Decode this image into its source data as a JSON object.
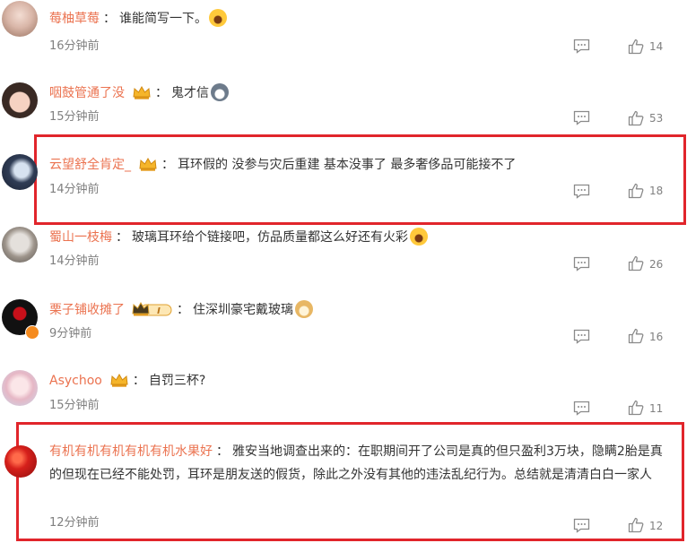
{
  "comments": [
    {
      "username": "莓柚草莓",
      "text": "谁能简写一下。",
      "time": "16分钟前",
      "likes": "14",
      "emoji": "surprised-emoji",
      "badge": "none"
    },
    {
      "username": "咽鼓管通了没",
      "text": "鬼才信",
      "time": "15分钟前",
      "likes": "53",
      "emoji": "husky-emoji",
      "badge": "crown"
    },
    {
      "username": "云望舒全肯定_",
      "text": "耳环假的 没参与灾后重建 基本没事了 最多奢侈品可能接不了",
      "time": "14分钟前",
      "likes": "18",
      "emoji": "",
      "badge": "crown"
    },
    {
      "username": "蜀山一枝梅",
      "text": "玻璃耳环给个链接吧，仿品质量都这么好还有火彩",
      "time": "14分钟前",
      "likes": "26",
      "emoji": "surprised-emoji",
      "badge": "none"
    },
    {
      "username": "栗子铺收摊了",
      "text": "住深圳豪宅戴玻璃",
      "time": "9分钟前",
      "likes": "16",
      "emoji": "doge-emoji",
      "badge": "crown-level",
      "badge_level": "I"
    },
    {
      "username": "Asychoo",
      "text": "自罚三杯?",
      "time": "15分钟前",
      "likes": "11",
      "emoji": "",
      "badge": "crown"
    },
    {
      "username": "有机有机有机有机有机水果好",
      "text": "雅安当地调查出来的：在职期间开了公司是真的但只盈利3万块，隐瞒2胎是真的但现在已经不能处罚，耳环是朋友送的假货，除此之外没有其他的违法乱纪行为。总结就是清清白白一家人",
      "time": "12分钟前",
      "likes": "12",
      "emoji": "",
      "badge": "none"
    }
  ],
  "colon": "：",
  "colors": {
    "username": "#eb7350",
    "highlight": "#e1252b",
    "meta": "#808080"
  }
}
